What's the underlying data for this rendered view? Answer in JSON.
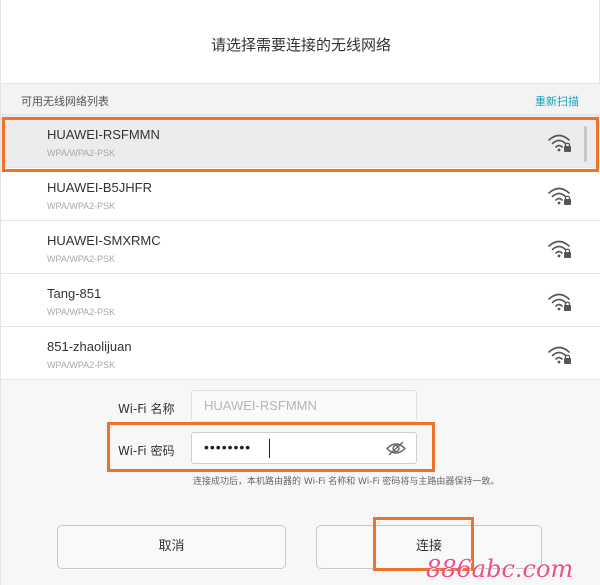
{
  "dialog": {
    "title": "请选择需要连接的无线网络",
    "list_title": "可用无线网络列表",
    "rescan_label": "重新扫描"
  },
  "networks": [
    {
      "name": "HUAWEI-RSFMMN",
      "security": "WPA/WPA2-PSK",
      "selected": true,
      "icon": "wifi-lock-icon"
    },
    {
      "name": "HUAWEI-B5JHFR",
      "security": "WPA/WPA2-PSK",
      "selected": false,
      "icon": "wifi-lock-icon"
    },
    {
      "name": "HUAWEI-SMXRMC",
      "security": "WPA/WPA2-PSK",
      "selected": false,
      "icon": "wifi-lock-icon"
    },
    {
      "name": "Tang-851",
      "security": "WPA/WPA2-PSK",
      "selected": false,
      "icon": "wifi-lock-icon"
    },
    {
      "name": "851-zhaolijuan",
      "security": "WPA/WPA2-PSK",
      "selected": false,
      "icon": "wifi-lock-icon"
    }
  ],
  "form": {
    "wifi_name_label": "Wi-Fi 名称",
    "wifi_name_value": "HUAWEI-RSFMMN",
    "wifi_password_label": "Wi-Fi 密码",
    "wifi_password_value": "••••••••",
    "hint": "连接成功后，本机路由器的 Wi-Fi 名称和 Wi-Fi 密码将与主路由器保持一致。"
  },
  "buttons": {
    "cancel_label": "取消",
    "connect_label": "连接"
  },
  "watermark": {
    "text": "886abc.com"
  },
  "colors": {
    "highlight": "#f07229",
    "accent": "#19a3b8",
    "watermark": "#f04e8a"
  }
}
